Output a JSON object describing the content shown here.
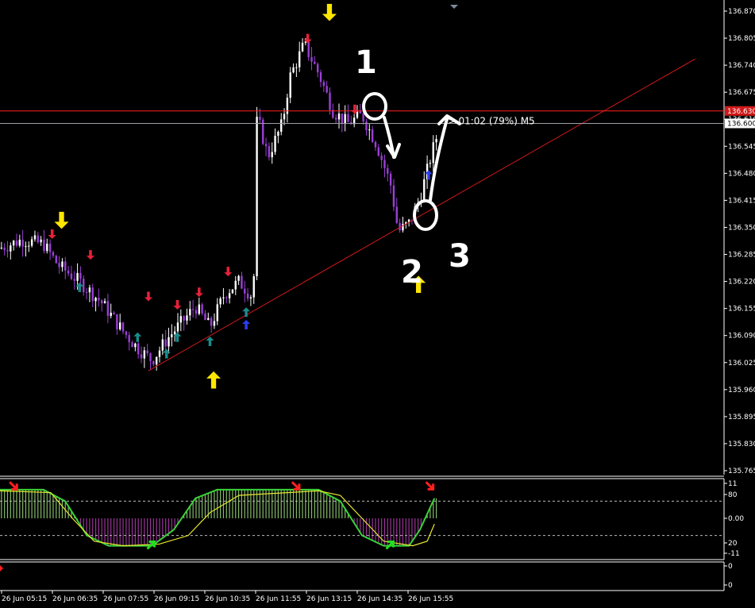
{
  "chart_data": [
    {
      "type": "candlestick",
      "panel": "price",
      "timeframe_label": "01:02 (79%) M5",
      "current_bid_label": "136.630",
      "current_price_label": "136.600",
      "bid_line_price": 136.63,
      "current_line_price": 136.6,
      "ylim": [
        135.765,
        136.87
      ],
      "y_ticks": [
        "136.870",
        "136.805",
        "136.740",
        "136.675",
        "136.610",
        "136.545",
        "136.480",
        "136.415",
        "136.350",
        "136.285",
        "136.220",
        "136.155",
        "136.090",
        "136.025",
        "135.960",
        "135.895",
        "135.830",
        "135.765"
      ],
      "x_ticks": [
        "26 Jun 05:15",
        "26 Jun 06:35",
        "26 Jun 07:55",
        "26 Jun 09:15",
        "26 Jun 10:35",
        "26 Jun 11:55",
        "26 Jun 13:15",
        "26 Jun 14:35",
        "26 Jun 15:55"
      ],
      "trendline": {
        "from": [
          0.205,
          136.005
        ],
        "to": [
          0.96,
          136.755
        ]
      },
      "key_closes": [
        {
          "x": 0.0,
          "y": 136.3
        },
        {
          "x": 0.03,
          "y": 136.32
        },
        {
          "x": 0.06,
          "y": 136.31
        },
        {
          "x": 0.08,
          "y": 136.26
        },
        {
          "x": 0.11,
          "y": 136.22
        },
        {
          "x": 0.14,
          "y": 136.17
        },
        {
          "x": 0.17,
          "y": 136.1
        },
        {
          "x": 0.19,
          "y": 136.06
        },
        {
          "x": 0.21,
          "y": 136.03
        },
        {
          "x": 0.23,
          "y": 136.08
        },
        {
          "x": 0.25,
          "y": 136.12
        },
        {
          "x": 0.27,
          "y": 136.16
        },
        {
          "x": 0.29,
          "y": 136.11
        },
        {
          "x": 0.31,
          "y": 136.19
        },
        {
          "x": 0.33,
          "y": 136.22
        },
        {
          "x": 0.35,
          "y": 136.18
        },
        {
          "x": 0.355,
          "y": 136.62
        },
        {
          "x": 0.37,
          "y": 136.52
        },
        {
          "x": 0.39,
          "y": 136.6
        },
        {
          "x": 0.4,
          "y": 136.71
        },
        {
          "x": 0.42,
          "y": 136.79
        },
        {
          "x": 0.44,
          "y": 136.72
        },
        {
          "x": 0.46,
          "y": 136.63
        },
        {
          "x": 0.48,
          "y": 136.6
        },
        {
          "x": 0.5,
          "y": 136.62
        },
        {
          "x": 0.52,
          "y": 136.55
        },
        {
          "x": 0.54,
          "y": 136.45
        },
        {
          "x": 0.55,
          "y": 136.34
        },
        {
          "x": 0.565,
          "y": 136.36
        },
        {
          "x": 0.58,
          "y": 136.42
        },
        {
          "x": 0.595,
          "y": 136.52
        },
        {
          "x": 0.605,
          "y": 136.58
        }
      ],
      "signals": [
        {
          "kind": "yellow-down",
          "x": 0.085,
          "y": 136.36
        },
        {
          "kind": "yellow-down",
          "x": 0.455,
          "y": 136.86
        },
        {
          "kind": "yellow-up",
          "x": 0.295,
          "y": 135.99
        },
        {
          "kind": "yellow-up",
          "x": 0.578,
          "y": 136.22
        },
        {
          "kind": "red-down",
          "x": 0.072,
          "y": 136.33
        },
        {
          "kind": "red-down",
          "x": 0.125,
          "y": 136.28
        },
        {
          "kind": "red-down",
          "x": 0.205,
          "y": 136.18
        },
        {
          "kind": "red-down",
          "x": 0.245,
          "y": 136.16
        },
        {
          "kind": "red-down",
          "x": 0.275,
          "y": 136.19
        },
        {
          "kind": "red-down",
          "x": 0.315,
          "y": 136.24
        },
        {
          "kind": "red-down",
          "x": 0.425,
          "y": 136.8
        },
        {
          "kind": "red-down",
          "x": 0.49,
          "y": 136.63
        },
        {
          "kind": "teal-up",
          "x": 0.11,
          "y": 136.21
        },
        {
          "kind": "teal-up",
          "x": 0.19,
          "y": 136.09
        },
        {
          "kind": "teal-up",
          "x": 0.23,
          "y": 136.05
        },
        {
          "kind": "teal-up",
          "x": 0.245,
          "y": 136.09
        },
        {
          "kind": "teal-up",
          "x": 0.29,
          "y": 136.08
        },
        {
          "kind": "teal-up",
          "x": 0.34,
          "y": 136.15
        },
        {
          "kind": "blue-up",
          "x": 0.34,
          "y": 136.12
        },
        {
          "kind": "blue-up",
          "x": 0.592,
          "y": 136.48
        }
      ],
      "annotations": [
        "1",
        "2",
        "3"
      ]
    },
    {
      "type": "oscillator",
      "panel": "stochastic",
      "y_ticks": [
        "11",
        "80",
        "0.00",
        "20",
        "-11"
      ],
      "levels": [
        80,
        20
      ],
      "ylim": [
        -11,
        111
      ],
      "main_line": [
        {
          "x": 0.0,
          "y": 100
        },
        {
          "x": 0.06,
          "y": 100
        },
        {
          "x": 0.09,
          "y": 80
        },
        {
          "x": 0.12,
          "y": 20
        },
        {
          "x": 0.15,
          "y": 2
        },
        {
          "x": 0.21,
          "y": 2
        },
        {
          "x": 0.24,
          "y": 30
        },
        {
          "x": 0.27,
          "y": 85
        },
        {
          "x": 0.3,
          "y": 100
        },
        {
          "x": 0.44,
          "y": 100
        },
        {
          "x": 0.47,
          "y": 80
        },
        {
          "x": 0.5,
          "y": 20
        },
        {
          "x": 0.53,
          "y": 2
        },
        {
          "x": 0.565,
          "y": 2
        },
        {
          "x": 0.58,
          "y": 30
        },
        {
          "x": 0.6,
          "y": 85
        }
      ],
      "signal_line": [
        {
          "x": 0.0,
          "y": 98
        },
        {
          "x": 0.07,
          "y": 95
        },
        {
          "x": 0.1,
          "y": 50
        },
        {
          "x": 0.13,
          "y": 10
        },
        {
          "x": 0.17,
          "y": 2
        },
        {
          "x": 0.22,
          "y": 5
        },
        {
          "x": 0.26,
          "y": 20
        },
        {
          "x": 0.29,
          "y": 60
        },
        {
          "x": 0.33,
          "y": 90
        },
        {
          "x": 0.44,
          "y": 98
        },
        {
          "x": 0.47,
          "y": 90
        },
        {
          "x": 0.5,
          "y": 50
        },
        {
          "x": 0.53,
          "y": 10
        },
        {
          "x": 0.57,
          "y": 2
        },
        {
          "x": 0.59,
          "y": 10
        },
        {
          "x": 0.6,
          "y": 40
        }
      ],
      "arrows": [
        {
          "kind": "red-down",
          "x": 0.02,
          "y": 105
        },
        {
          "kind": "green-up",
          "x": 0.21,
          "y": 5
        },
        {
          "kind": "red-down",
          "x": 0.41,
          "y": 105
        },
        {
          "kind": "green-up",
          "x": 0.54,
          "y": 5
        },
        {
          "kind": "red-down",
          "x": 0.595,
          "y": 105
        }
      ]
    },
    {
      "type": "indicator",
      "panel": "bottom",
      "y_ticks": [
        "0",
        "0"
      ]
    }
  ],
  "colors": {
    "background": "#000000",
    "grid": "#ffffff",
    "bull_candle": "#ffffff",
    "bear_candle": "#9b3fd6",
    "trendline": "#d01818",
    "bid_line": "#ff2020",
    "price_line": "#9aa0a6",
    "main_line": "#3ad13a",
    "signal_line": "#e8e830",
    "hist_up": "#9bdc7a",
    "hist_down": "#b93db5"
  }
}
